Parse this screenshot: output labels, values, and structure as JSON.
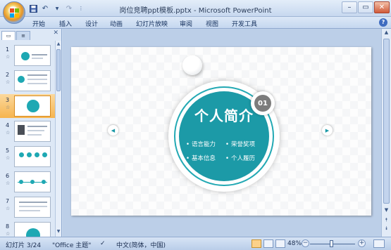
{
  "window": {
    "title": "岗位竞聘ppt模板.pptx - Microsoft PowerPoint",
    "quick_access": [
      "save-icon",
      "undo-icon",
      "redo-icon",
      "customize-icon"
    ],
    "controls": [
      "minimize",
      "maximize",
      "close"
    ]
  },
  "ribbon": {
    "tabs": [
      "开始",
      "插入",
      "设计",
      "动画",
      "幻灯片放映",
      "审阅",
      "视图",
      "开发工具"
    ]
  },
  "slides_pane": {
    "thumbnails": [
      {
        "number": "1",
        "marker": "☆"
      },
      {
        "number": "2",
        "marker": "☆"
      },
      {
        "number": "3",
        "marker": "☆"
      },
      {
        "number": "4",
        "marker": "☆"
      },
      {
        "number": "5",
        "marker": "☆"
      },
      {
        "number": "6",
        "marker": "☆"
      },
      {
        "number": "7",
        "marker": "☆"
      },
      {
        "number": "8",
        "marker": "☆"
      }
    ],
    "active_index": 3
  },
  "slide": {
    "badge": "01",
    "title": "个人简介",
    "items": [
      "语言能力",
      "荣誉奖项",
      "基本信息",
      "个人履历"
    ],
    "accent_color": "#1c9aa7"
  },
  "statusbar": {
    "slide_indicator": "幻灯片 3/24",
    "theme": "\"Office 主题\"",
    "language": "中文(简体，中国)",
    "zoom": "48%"
  }
}
